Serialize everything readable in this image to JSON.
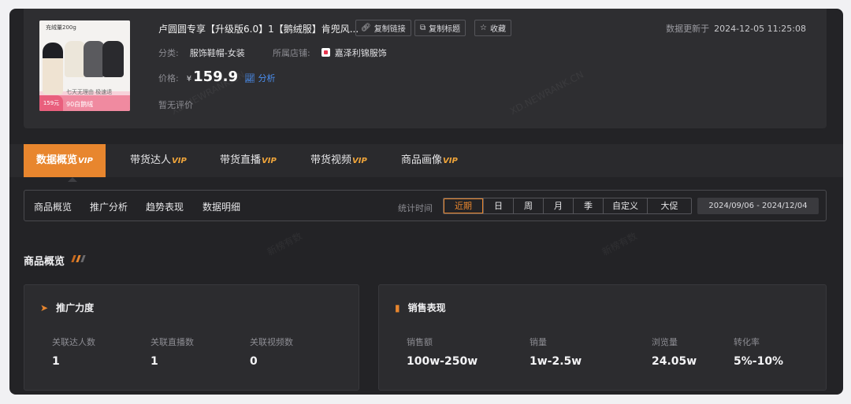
{
  "product": {
    "title": "卢圆圆专享【升级版6.0】1【鹅绒服】肯兜风...",
    "category_label": "分类:",
    "category": "服饰鞋帽-女装",
    "shop_label": "所属店铺:",
    "shop": "嘉泽利锦服饰",
    "price_label": "价格:",
    "currency": "¥",
    "price": "159.9",
    "analysis_label": "分析",
    "no_review": "暂无评价",
    "thumb": {
      "tag_top": "充绒量200g",
      "tag_mid": "七天无理由 极速退",
      "price": "159元",
      "bottom": "90白鹅绒"
    }
  },
  "actions": {
    "copy_link": "复制链接",
    "copy_title": "复制标题",
    "favorite": "收藏"
  },
  "updated": {
    "label": "数据更新于",
    "time": "2024-12-05 11:25:08"
  },
  "tabs": [
    {
      "label": "数据概览",
      "vip": "VIP"
    },
    {
      "label": "带货达人",
      "vip": "VIP"
    },
    {
      "label": "带货直播",
      "vip": "VIP"
    },
    {
      "label": "带货视频",
      "vip": "VIP"
    },
    {
      "label": "商品画像",
      "vip": "VIP"
    }
  ],
  "subnav": [
    "商品概览",
    "推广分析",
    "趋势表现",
    "数据明细"
  ],
  "filter": {
    "label": "统计时间",
    "options": [
      "近期",
      "日",
      "周",
      "月",
      "季",
      "自定义",
      "大促"
    ],
    "selected": "近期",
    "date_range": "2024/09/06  -  2024/12/04"
  },
  "section_title": "商品概览",
  "promo": {
    "title": "推广力度",
    "metrics": [
      {
        "label": "关联达人数",
        "value": "1"
      },
      {
        "label": "关联直播数",
        "value": "1"
      },
      {
        "label": "关联视频数",
        "value": "0"
      }
    ]
  },
  "sales": {
    "title": "销售表现",
    "metrics": [
      {
        "label": "销售额",
        "value": "100w-250w"
      },
      {
        "label": "销量",
        "value": "1w-2.5w"
      },
      {
        "label": "浏览量",
        "value": "24.05w"
      },
      {
        "label": "转化率",
        "value": "5%-10%"
      }
    ]
  },
  "watermarks": {
    "domain": "XD.NEWRANK.CN",
    "brand": "新榜有数"
  },
  "colors": {
    "accent": "#e8862e",
    "link": "#4b8ff0",
    "vip": "#f0a53a",
    "background": "#232326"
  }
}
